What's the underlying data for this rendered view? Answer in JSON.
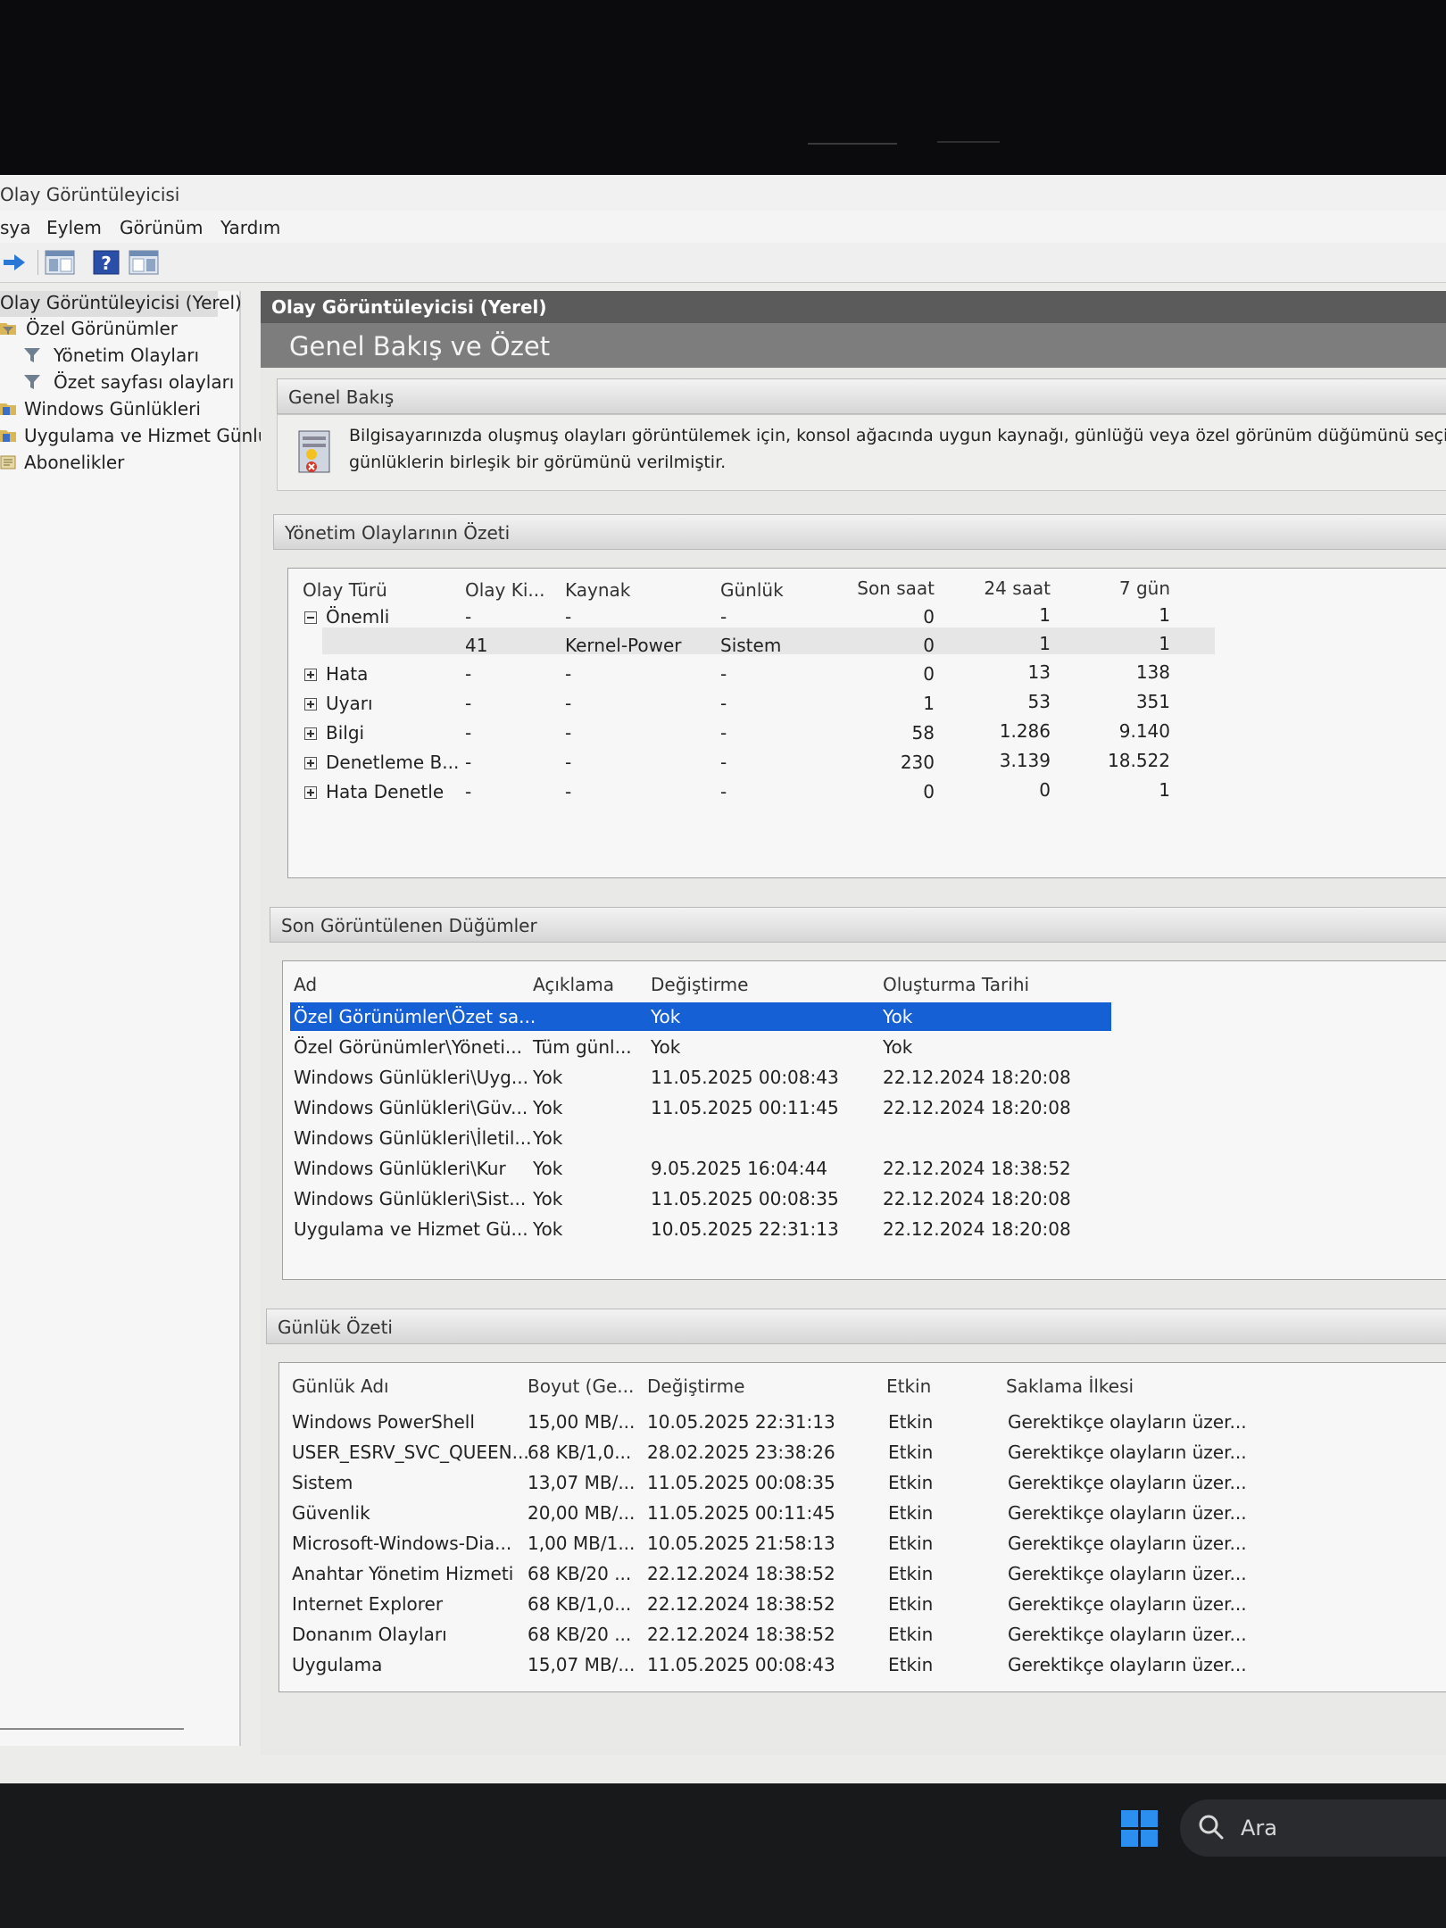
{
  "window": {
    "title": "Olay Görüntüleyicisi"
  },
  "menu": [
    "sya",
    "Eylem",
    "Görünüm",
    "Yardım"
  ],
  "tree": {
    "items": [
      {
        "label": "Olay Görüntüleyicisi (Yerel)"
      },
      {
        "label": "Özel Görünümler"
      },
      {
        "label": "Yönetim Olayları"
      },
      {
        "label": "Özet sayfası olayları"
      },
      {
        "label": "Windows Günlükleri"
      },
      {
        "label": "Uygulama ve Hizmet Günlük"
      },
      {
        "label": "Abonelikler"
      }
    ]
  },
  "main": {
    "header": "Olay Görüntüleyicisi (Yerel)",
    "title": "Genel Bakış ve Özet",
    "overview": {
      "title": "Genel Bakış",
      "text_line1": "Bilgisayarınızda oluşmuş olayları görüntülemek için, konsol ağacında uygun kaynağı, günlüğü veya özel görünüm düğümünü seçin. Y",
      "text_line2": "günlüklerin birleşik bir görümünü verilmiştir."
    }
  },
  "admin_summary": {
    "title": "Yönetim Olaylarının Özeti",
    "headers": [
      "Olay Türü",
      "Olay Ki...",
      "Kaynak",
      "Günlük",
      "Son saat",
      "24 saat",
      "7 gün"
    ],
    "rows": [
      {
        "type": "Önemli",
        "id": "-",
        "source": "-",
        "log": "-",
        "hour": "0",
        "day": "1",
        "week": "1",
        "expander": "minus"
      },
      {
        "type": "",
        "id": "41",
        "source": "Kernel-Power",
        "log": "Sistem",
        "hour": "0",
        "day": "1",
        "week": "1",
        "expander": "none"
      },
      {
        "type": "Hata",
        "id": "-",
        "source": "-",
        "log": "-",
        "hour": "0",
        "day": "13",
        "week": "138",
        "expander": "plus"
      },
      {
        "type": "Uyarı",
        "id": "-",
        "source": "-",
        "log": "-",
        "hour": "1",
        "day": "53",
        "week": "351",
        "expander": "plus"
      },
      {
        "type": "Bilgi",
        "id": "-",
        "source": "-",
        "log": "-",
        "hour": "58",
        "day": "1.286",
        "week": "9.140",
        "expander": "plus"
      },
      {
        "type": "Denetleme B...",
        "id": "-",
        "source": "-",
        "log": "-",
        "hour": "230",
        "day": "3.139",
        "week": "18.522",
        "expander": "plus"
      },
      {
        "type": "Hata Denetle",
        "id": "-",
        "source": "-",
        "log": "-",
        "hour": "0",
        "day": "0",
        "week": "1",
        "expander": "plus"
      }
    ]
  },
  "recent_nodes": {
    "title": "Son Görüntülenen Düğümler",
    "headers": [
      "Ad",
      "Açıklama",
      "Değiştirme",
      "Oluşturma Tarihi"
    ],
    "rows": [
      {
        "name": "Özel Görünümler\\Özet sa...",
        "desc": "",
        "modified": "Yok",
        "created": "Yok"
      },
      {
        "name": "Özel Görünümler\\Yöneti...",
        "desc": "Tüm günl...",
        "modified": "Yok",
        "created": "Yok"
      },
      {
        "name": "Windows Günlükleri\\Uyg...",
        "desc": "Yok",
        "modified": "11.05.2025 00:08:43",
        "created": "22.12.2024 18:20:08"
      },
      {
        "name": "Windows Günlükleri\\Güv...",
        "desc": "Yok",
        "modified": "11.05.2025 00:11:45",
        "created": "22.12.2024 18:20:08"
      },
      {
        "name": "Windows Günlükleri\\İletil...",
        "desc": "Yok",
        "modified": "",
        "created": ""
      },
      {
        "name": "Windows Günlükleri\\Kur",
        "desc": "Yok",
        "modified": "9.05.2025 16:04:44",
        "created": "22.12.2024 18:38:52"
      },
      {
        "name": "Windows Günlükleri\\Sist...",
        "desc": "Yok",
        "modified": "11.05.2025 00:08:35",
        "created": "22.12.2024 18:20:08"
      },
      {
        "name": "Uygulama ve Hizmet Gü...",
        "desc": "Yok",
        "modified": "10.05.2025 22:31:13",
        "created": "22.12.2024 18:20:08"
      }
    ]
  },
  "log_summary": {
    "title": "Günlük Özeti",
    "headers": [
      "Günlük Adı",
      "Boyut (Ge...",
      "Değiştirme",
      "Etkin",
      "Saklama İlkesi"
    ],
    "rows": [
      {
        "name": "Windows PowerShell",
        "size": "15,00 MB/...",
        "modified": "10.05.2025 22:31:13",
        "enabled": "Etkin",
        "policy": "Gerektikçe olayların üzer..."
      },
      {
        "name": "USER_ESRV_SVC_QUEEN...",
        "size": "68 KB/1,0...",
        "modified": "28.02.2025 23:38:26",
        "enabled": "Etkin",
        "policy": "Gerektikçe olayların üzer..."
      },
      {
        "name": "Sistem",
        "size": "13,07 MB/...",
        "modified": "11.05.2025 00:08:35",
        "enabled": "Etkin",
        "policy": "Gerektikçe olayların üzer..."
      },
      {
        "name": "Güvenlik",
        "size": "20,00 MB/...",
        "modified": "11.05.2025 00:11:45",
        "enabled": "Etkin",
        "policy": "Gerektikçe olayların üzer..."
      },
      {
        "name": "Microsoft-Windows-Dia...",
        "size": "1,00 MB/1...",
        "modified": "10.05.2025 21:58:13",
        "enabled": "Etkin",
        "policy": "Gerektikçe olayların üzer..."
      },
      {
        "name": "Anahtar Yönetim Hizmeti",
        "size": "68 KB/20 ...",
        "modified": "22.12.2024 18:38:52",
        "enabled": "Etkin",
        "policy": "Gerektikçe olayların üzer..."
      },
      {
        "name": "Internet Explorer",
        "size": "68 KB/1,0...",
        "modified": "22.12.2024 18:38:52",
        "enabled": "Etkin",
        "policy": "Gerektikçe olayların üzer..."
      },
      {
        "name": "Donanım Olayları",
        "size": "68 KB/20 ...",
        "modified": "22.12.2024 18:38:52",
        "enabled": "Etkin",
        "policy": "Gerektikçe olayların üzer..."
      },
      {
        "name": "Uygulama",
        "size": "15,07 MB/...",
        "modified": "11.05.2025 00:08:43",
        "enabled": "Etkin",
        "policy": "Gerektikçe olayların üzer..."
      }
    ]
  },
  "taskbar": {
    "search_placeholder": "Ara"
  },
  "colors": {
    "selection": "#1560d4",
    "header_bar": "#5b5b5b",
    "windows_logo": "#2b8ff0"
  }
}
